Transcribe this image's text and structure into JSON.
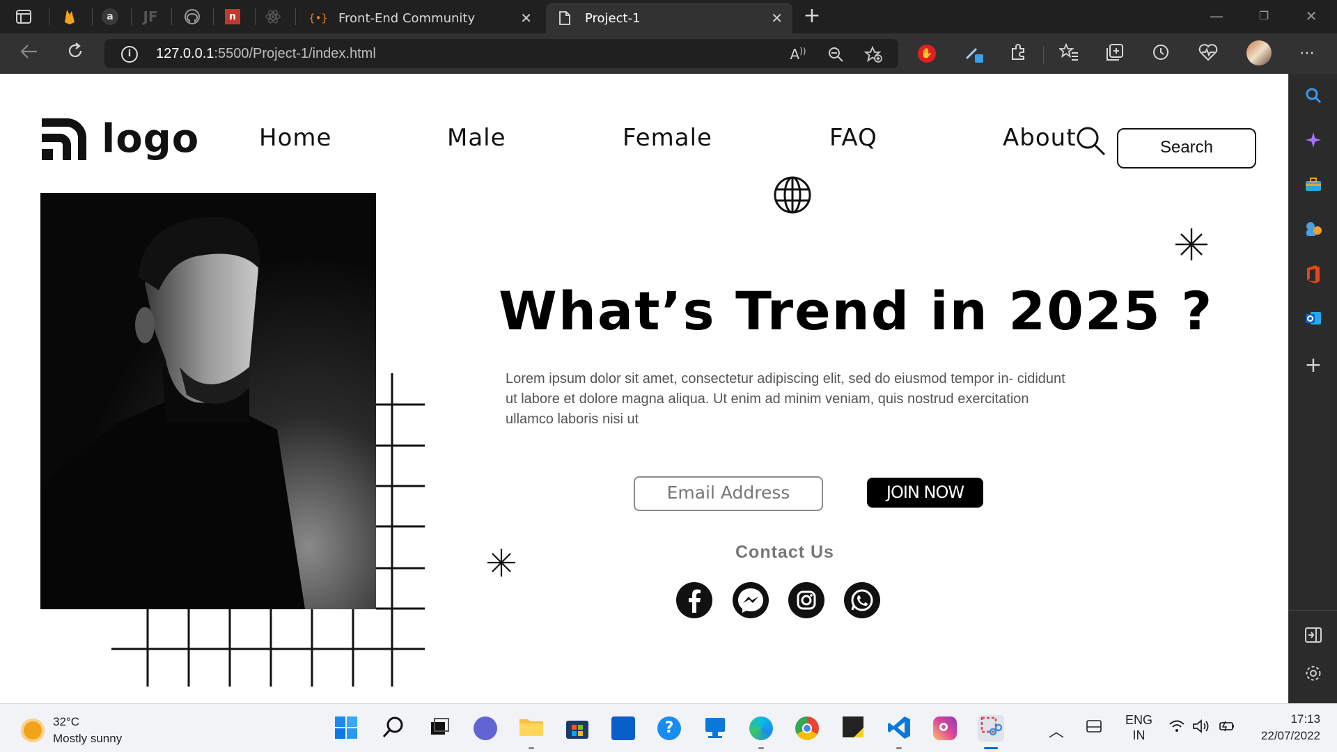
{
  "browser": {
    "pinned_tabs": [
      "window-icon",
      "firebase-icon",
      "amazon-icon",
      "jf-icon",
      "github-icon",
      "note-icon",
      "react-icon"
    ],
    "tabs": [
      {
        "title": "Front-End Community",
        "favicon": "{•}",
        "active": false
      },
      {
        "title": "Project-1",
        "favicon": "",
        "active": true
      }
    ],
    "url_host": "127.0.0.1",
    "url_path": ":5500/Project-1/index.html"
  },
  "page": {
    "logo_text": "logo",
    "nav": [
      "Home",
      "Male",
      "Female",
      "FAQ",
      "About"
    ],
    "search_label": "Search",
    "headline": "What’s Trend in 2025 ?",
    "lead": "Lorem ipsum dolor sit amet, consectetur adipiscing elit, sed do eiusmod tempor in- cididunt ut labore et dolore magna aliqua. Ut enim ad minim veniam, quis nostrud exercitation ullamco laboris nisi ut",
    "email_placeholder": "Email Address",
    "join_label": "JOIN NOW",
    "contact_label": "Contact Us",
    "social": [
      "facebook-icon",
      "messenger-icon",
      "instagram-icon",
      "whatsapp-icon"
    ]
  },
  "taskbar": {
    "temperature": "32°C",
    "weather": "Mostly sunny",
    "lang_line1": "ENG",
    "lang_line2": "IN",
    "time": "17:13",
    "date": "22/07/2022"
  },
  "colors": {
    "accent": "#0a66d8",
    "page_bg": "#ffffff",
    "chrome_bg": "#202020"
  }
}
